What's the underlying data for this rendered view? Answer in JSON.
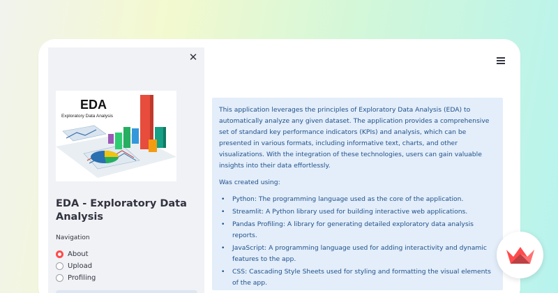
{
  "sidebar": {
    "close_icon": "close-icon",
    "logo": {
      "heading": "EDA",
      "subheading": "Exploratory Data Analysis"
    },
    "app_title": "EDA - Exploratory Data Analysis",
    "navigation_label": "Navigation",
    "nav_options": [
      {
        "label": "About",
        "selected": true
      },
      {
        "label": "Upload",
        "selected": false
      },
      {
        "label": "Profiling",
        "selected": false
      }
    ]
  },
  "header": {
    "menu_icon": "hamburger-menu-icon"
  },
  "main": {
    "intro": "This application leverages the principles of Exploratory Data Analysis (EDA) to automatically analyze any given dataset. The application provides a comprehensive set of standard key performance indicators (KPIs) and analysis, which can be presented in various formats, including informative text, charts, and other visualizations. With the integration of these technologies, users can gain valuable insights into their data effortlessly.",
    "created_using_label": "Was created using:",
    "technologies": [
      "Python: The programming language used as the core of the application.",
      "Streamlit: A Python library used for building interactive web applications.",
      "Pandas Profiling: A library for generating detailed exploratory data analysis reports.",
      "JavaScript: A programming language used for adding interactivity and dynamic features to the app.",
      "CSS: Cascading Style Sheets used for styling and formatting the visual elements of the app."
    ]
  },
  "colors": {
    "accent": "#ff4b4b",
    "info_bg": "#e3eefa",
    "info_text": "#1f4f8a",
    "sidebar_bg": "#f0f2f6"
  },
  "brand_icon": "streamlit-crown-icon"
}
